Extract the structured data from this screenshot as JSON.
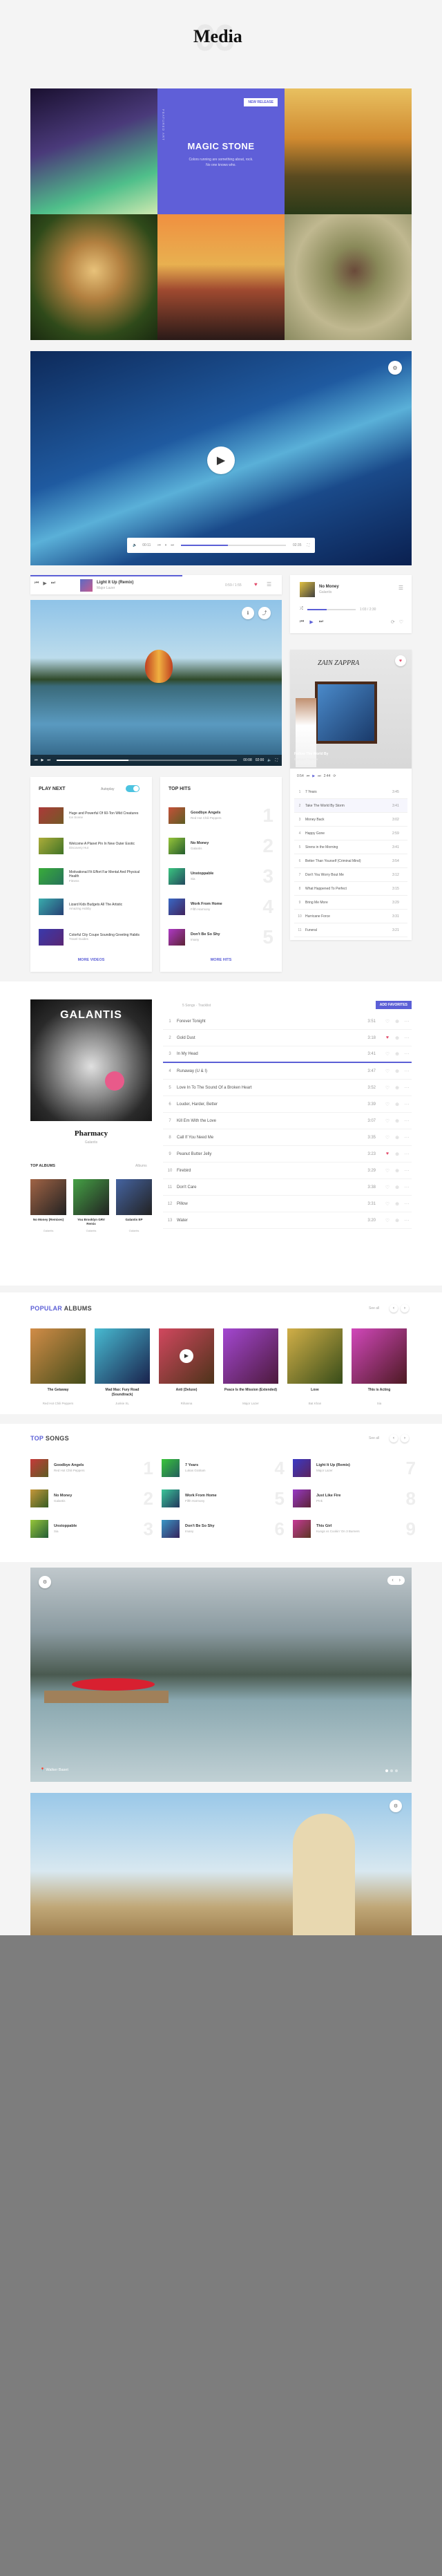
{
  "page": {
    "title": "Media",
    "bg_number": "06"
  },
  "gallery": {
    "center": {
      "badge": "NEW RELEASE",
      "label": "FEATURED ART",
      "title": "MAGIC STONE",
      "text": "Colors running are something about, rock. No one knows who."
    }
  },
  "video1": {
    "time_start": "00:11",
    "time_end": "02:35"
  },
  "mini_player1": {
    "title": "Light It Up (Remix)",
    "artist": "Major Lazer",
    "time": "0:59 / 1:55"
  },
  "mini_player2": {
    "title": "No Money",
    "artist": "Galantis",
    "time": "1:03 / 2:30"
  },
  "video2": {
    "time_start": "00:08",
    "time_end": "02:00"
  },
  "feature_card": {
    "title": "Follow The World By",
    "subtitle": "Glorious Thunder",
    "sign": "ZAIN ZAPPRA"
  },
  "feature_player": {
    "time_start": "0:54",
    "time_end": "2:44"
  },
  "play_next": {
    "title": "PLAY NEXT",
    "autoplay_label": "Autoplay",
    "more": "MORE VIDEOS",
    "items": [
      {
        "title": "Huge and Powerful Of 60-Ton Wild Creatures",
        "sub": "Ice Scene"
      },
      {
        "title": "Welcome A Planet Pin In New Outer Exotic",
        "sub": "Discovery Hut"
      },
      {
        "title": "Motivational Fit Effort Far Mental And Physical Health",
        "sub": "Fitness"
      },
      {
        "title": "Lizard Kids Budgets All The Artistic",
        "sub": "Amazing Hobby"
      },
      {
        "title": "Colorful City Coupe Sounding Greeting Habits",
        "sub": "Travel Guides"
      }
    ]
  },
  "top_hits": {
    "title": "TOP HITS",
    "more": "MORE HITS",
    "items": [
      {
        "title": "Goodbye Angels",
        "sub": "Red Hot Chili Peppers",
        "num": "1"
      },
      {
        "title": "No Money",
        "sub": "Galantis",
        "num": "2"
      },
      {
        "title": "Unstoppable",
        "sub": "Sia",
        "num": "3"
      },
      {
        "title": "Work From Home",
        "sub": "Fifth Harmony",
        "num": "4"
      },
      {
        "title": "Don't Be So Shy",
        "sub": "Imany",
        "num": "5"
      }
    ]
  },
  "right_tracks": [
    {
      "n": "1",
      "t": "7 Years",
      "d": "3:45"
    },
    {
      "n": "2",
      "t": "Take The World By Storm",
      "d": "3:41"
    },
    {
      "n": "3",
      "t": "Money Back",
      "d": "3:02"
    },
    {
      "n": "4",
      "t": "Happy Gone",
      "d": "2:59"
    },
    {
      "n": "5",
      "t": "Sirens in the Morning",
      "d": "3:41"
    },
    {
      "n": "6",
      "t": "Better Than Yourself (Criminal Mind)",
      "d": "3:54"
    },
    {
      "n": "7",
      "t": "Don't You Worry Bout Me",
      "d": "3:12"
    },
    {
      "n": "8",
      "t": "What Happened To Perfect",
      "d": "3:15"
    },
    {
      "n": "9",
      "t": "Bring Me More",
      "d": "3:29"
    },
    {
      "n": "10",
      "t": "Hurricane Force",
      "d": "3:31"
    },
    {
      "n": "11",
      "t": "Funeral",
      "d": "3:21"
    }
  ],
  "album": {
    "cover_title": "GALANTIS",
    "name": "Pharmacy",
    "artist": "Galantis",
    "top_albums": "TOP ALBUMS",
    "albums_more": "Albums",
    "mini": [
      {
        "t": "No Money (Remixes)",
        "s": "Galantis"
      },
      {
        "t": "You Brooklyn GRV Remix",
        "s": "Galantis"
      },
      {
        "t": "Galantis EP",
        "s": "Galantis"
      }
    ]
  },
  "queue": {
    "label": "5 Songs · Tracklist",
    "button": "ADD FAVORITES",
    "rows": [
      {
        "n": "1",
        "t": "Forever Tonight",
        "d": "3:51"
      },
      {
        "n": "2",
        "t": "Gold Dust",
        "d": "3:18"
      },
      {
        "n": "3",
        "t": "In My Head",
        "d": "3:41"
      },
      {
        "n": "4",
        "t": "Runaway (U & I)",
        "d": "3:47"
      },
      {
        "n": "5",
        "t": "Love In To The Sound Of a Broken Heart",
        "d": "3:52"
      },
      {
        "n": "6",
        "t": "Louder, Harder, Better",
        "d": "3:39"
      },
      {
        "n": "7",
        "t": "Kill Em With the Love",
        "d": "3:07"
      },
      {
        "n": "8",
        "t": "Call If You Need Me",
        "d": "3:35"
      },
      {
        "n": "9",
        "t": "Peanut Butter Jelly",
        "d": "3:23"
      },
      {
        "n": "10",
        "t": "Firebird",
        "d": "3:29"
      },
      {
        "n": "11",
        "t": "Don't Care",
        "d": "3:38"
      },
      {
        "n": "12",
        "t": "Pillow",
        "d": "3:31"
      },
      {
        "n": "13",
        "t": "Water",
        "d": "3:20"
      }
    ]
  },
  "popular_albums": {
    "title_a": "POPULAR",
    "title_b": " ALBUMS",
    "see_all": "See all",
    "items": [
      {
        "t": "The Getaway",
        "s": "Red Hot Chili Peppers"
      },
      {
        "t": "Mad Max: Fury Road (Soundtrack)",
        "s": "Junkie XL"
      },
      {
        "t": "Anti (Deluxe)",
        "s": "Rihanna"
      },
      {
        "t": "Peace Is the Mission (Extended)",
        "s": "Major Lazer"
      },
      {
        "t": "Love",
        "s": "Bat Khan"
      },
      {
        "t": "This is Acting",
        "s": "Sia"
      }
    ]
  },
  "top_songs": {
    "title_a": "TOP",
    "title_b": " SONGS",
    "see_all": "See all",
    "items": [
      {
        "t": "Goodbye Angels",
        "s": "Red Hot Chili Peppers",
        "n": "1"
      },
      {
        "t": "No Money",
        "s": "Galantis",
        "n": "2"
      },
      {
        "t": "Unstoppable",
        "s": "Sia",
        "n": "3"
      },
      {
        "t": "7 Years",
        "s": "Lukas Graham",
        "n": "4"
      },
      {
        "t": "Work From Home",
        "s": "Fifth Harmony",
        "n": "5"
      },
      {
        "t": "Don't Be So Shy",
        "s": "Imany",
        "n": "6"
      },
      {
        "t": "Light It Up (Remix)",
        "s": "Major Lazer",
        "n": "7"
      },
      {
        "t": "Just Like Fire",
        "s": "P!nk",
        "n": "8"
      },
      {
        "t": "This Girl",
        "s": "Kungs vs Cookin' On 3 Burners",
        "n": "9"
      }
    ]
  },
  "photo1": {
    "location": "Walker Baset"
  },
  "colors": {
    "accent": "#5b5fd6",
    "heart": "#e24a6a"
  }
}
